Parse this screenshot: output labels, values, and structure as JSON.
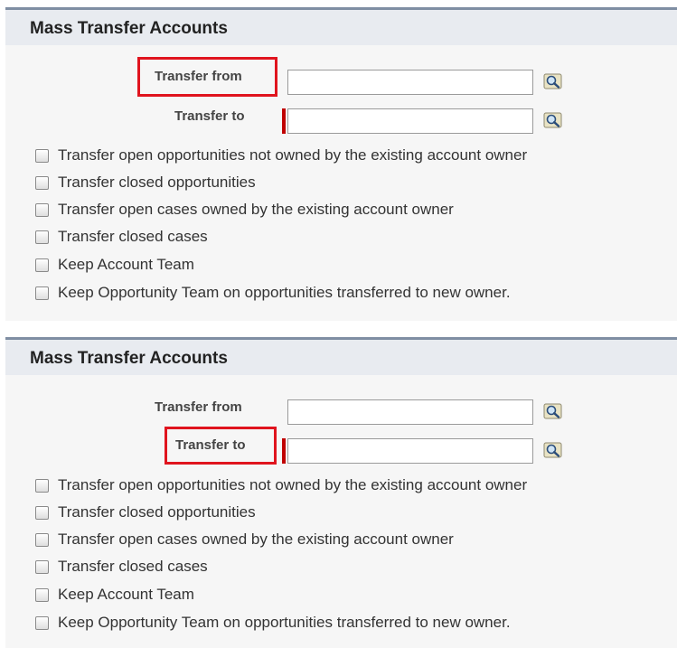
{
  "panels": [
    {
      "title": "Mass Transfer Accounts",
      "transfer_from_label": "Transfer from",
      "transfer_from_value": "",
      "transfer_to_label": "Transfer to",
      "transfer_to_value": "",
      "highlighted_field": "Transfer from",
      "options": [
        "Transfer open opportunities not owned by the existing account owner",
        "Transfer closed opportunities",
        "Transfer open cases owned by the existing account owner",
        "Transfer closed cases",
        "Keep Account Team",
        "Keep Opportunity Team on opportunities transferred to new owner."
      ]
    },
    {
      "title": "Mass Transfer Accounts",
      "transfer_from_label": "Transfer from",
      "transfer_from_value": "",
      "transfer_to_label": "Transfer to",
      "transfer_to_value": "",
      "highlighted_field": "Transfer to",
      "options": [
        "Transfer open opportunities not owned by the existing account owner",
        "Transfer closed opportunities",
        "Transfer open cases owned by the existing account owner",
        "Transfer closed cases",
        "Keep Account Team",
        "Keep Opportunity Team on opportunities transferred to new owner."
      ]
    }
  ],
  "icons": {
    "lookup": "magnifier-lookup-icon"
  },
  "colors": {
    "highlight": "#e0141e",
    "required": "#c00000",
    "header_bg": "#e8ebf0",
    "panel_bg": "#f6f6f6"
  }
}
